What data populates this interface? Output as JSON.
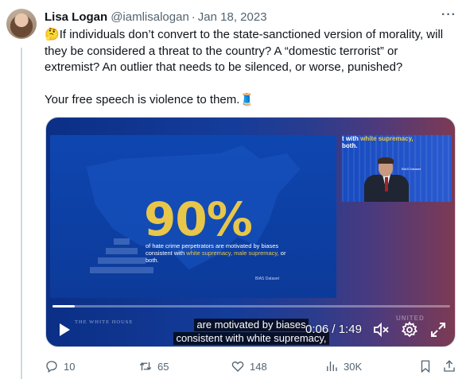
{
  "tweet": {
    "display_name": "Lisa Logan",
    "handle": "@iamlisalogan",
    "separator": "·",
    "date": "Jan 18, 2023",
    "more_icon": "more-horizontal-icon",
    "text_paragraph_1": "If individuals don’t convert to the state-sanctioned version of morality, will they be considered a threat to the country? A “domestic terrorist” or extremist? An outlier that needs to be silenced, or worse, punished?",
    "lead_emoji": "🤔",
    "text_paragraph_2": "Your free speech is violence to them.",
    "trail_emoji": "🧵"
  },
  "video": {
    "slide_big_number": "90%",
    "slide_text_part1": "of hate crime perpetrators are motivated by biases consistent with ",
    "slide_text_highlight": "white supremacy, male supremacy,",
    "slide_text_part2": " or both.",
    "slide_source": "BIAS Dataset",
    "inset_caption_line1_plain": "t with ",
    "inset_caption_line1_hl": "white supremacy,",
    "inset_caption_line2": "both.",
    "inset_tag": "BIAS Dataset",
    "watermark_left": "THE WHITE HOUSE",
    "watermark_right": "UNITED",
    "caption_line_1": "are motivated by biases",
    "caption_line_2": "consistent with white supremacy,",
    "current_time": "0:06",
    "time_separator": "/",
    "duration": "1:49",
    "progress_fraction": 0.055,
    "controls": [
      "play-icon",
      "volume-muted-icon",
      "settings-gear-icon",
      "fullscreen-expand-icon"
    ]
  },
  "actions": {
    "replies": "10",
    "retweets": "65",
    "likes": "148",
    "views": "30K"
  },
  "colors": {
    "accent_yellow": "#e8c64a",
    "slide_blue": "#0c3a99",
    "muted_text": "#536471"
  }
}
